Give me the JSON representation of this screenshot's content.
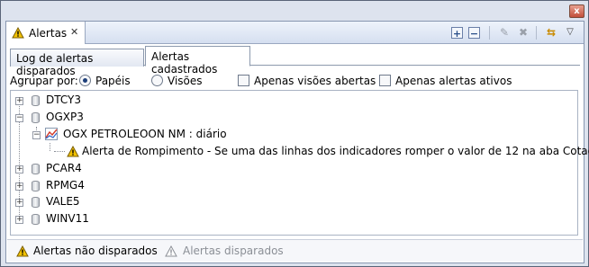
{
  "view_tab": {
    "title": "Alertas",
    "close_glyph": "✕"
  },
  "toolbar": {
    "expand_all": "+",
    "collapse_all": "−",
    "edit_glyph": "✎",
    "delete_glyph": "✖",
    "sync_glyph": "⇆",
    "menu_glyph": "▽"
  },
  "window": {
    "close_glyph": "x"
  },
  "subtabs": [
    "Log de alertas disparados",
    "Alertas cadastrados"
  ],
  "group_by": {
    "label": "Agrupar por:",
    "options": [
      "Papéis",
      "Visões"
    ],
    "selected": "Papéis"
  },
  "filters": [
    {
      "label": "Apenas visões abertas",
      "checked": false
    },
    {
      "label": "Apenas alertas ativos",
      "checked": false
    }
  ],
  "tree": {
    "nodes": [
      {
        "label": "DTCY3",
        "expanded": false
      },
      {
        "label": "OGXP3",
        "expanded": true,
        "child": {
          "label": "OGX PETROLEOON NM : diário",
          "alert": "Alerta de Rompimento - Se uma das linhas dos indicadores romper o valor de 12 na aba Cotação."
        }
      },
      {
        "label": "PCAR4",
        "expanded": false
      },
      {
        "label": "RPMG4",
        "expanded": false
      },
      {
        "label": "VALE5",
        "expanded": false
      },
      {
        "label": "WINV11",
        "expanded": false
      }
    ]
  },
  "status": [
    {
      "label": "Alertas não disparados",
      "enabled": true
    },
    {
      "label": "Alertas disparados",
      "enabled": false
    }
  ],
  "colors": {
    "warning": "#f2c200",
    "accent": "#1d3f7a",
    "chart_red": "#d23a2a",
    "chart_blue": "#2f63c8"
  }
}
